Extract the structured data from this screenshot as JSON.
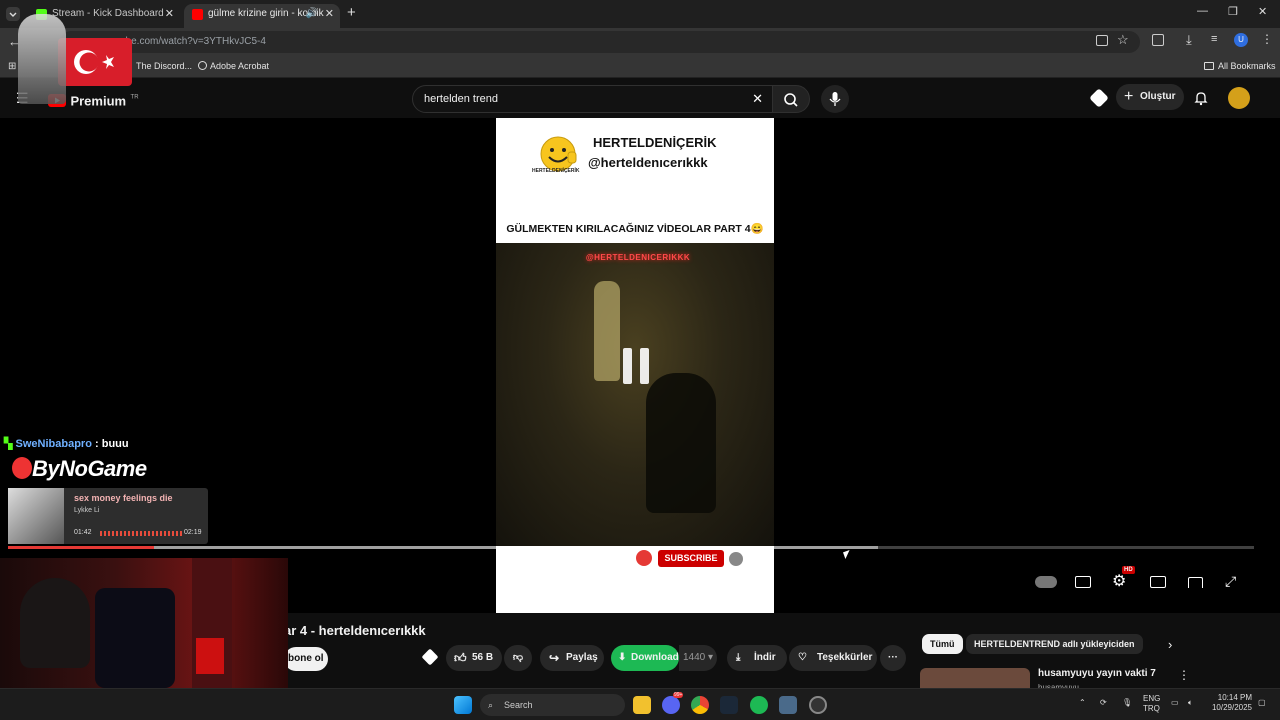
{
  "tabs": [
    {
      "title": "Stream - Kick Dashboard",
      "active": false
    },
    {
      "title": "gülme krizine girin - komik",
      "active": true
    }
  ],
  "address": {
    "url": "ube.com/watch?v=3YTHkvJC5-4"
  },
  "bookmarks": {
    "discord": "The Discord...",
    "acrobat": "Adobe Acrobat",
    "all": "All Bookmarks"
  },
  "youtube": {
    "logo_label": "Premium",
    "logo_region": "TR",
    "search_value": "hertelden trend",
    "create_label": "Oluştur"
  },
  "video": {
    "channel_name": "HERTELDENİÇERİK",
    "channel_handle": "@herteldenıcerıkkk",
    "logo_caption": "HERTELDENİÇERİK",
    "banner_text": "GÜLMEKTEN KIRILACAĞINIZ VİDEOLAR PART 4😄",
    "watermark": "@HERTELDENICERIKKK",
    "subscribe_label": "SUBSCRIBE",
    "hd_badge": "HD"
  },
  "below": {
    "title": "ar 4 - herteldenıcerıkkk",
    "subscribe_label": "bone ol",
    "like_count": "56 B",
    "share_label": "Paylaş",
    "download_label": "Download",
    "download_quality": "1440",
    "save_label": "İndir",
    "thanks_label": "Teşekkürler"
  },
  "sidebar": {
    "chips": [
      "Tümü",
      "HERTELDENTREND adlı yükleyiciden"
    ],
    "first_video_title": "husamyuyu yayın vakti 7",
    "first_video_channel": "husamyuyu..."
  },
  "overlay": {
    "chat_user": "SweNibabapro",
    "chat_message": ": buuu",
    "brand": "ByNoGame",
    "song_title": "sex money feelings die",
    "song_artist": "Lykke Li",
    "song_elapsed": "01:42",
    "song_total": "02:19",
    "song_progress": 0.73
  },
  "taskbar": {
    "search_placeholder": "Search",
    "lang": "ENG",
    "lang2": "TRQ",
    "time": "10:14 PM",
    "date": "10/29/2025",
    "badge": "99+"
  },
  "colors": {
    "youtube_red": "#ff0000",
    "download_green": "#1db954",
    "kick_green": "#53fc18",
    "subscribe_red": "#cc0000"
  }
}
